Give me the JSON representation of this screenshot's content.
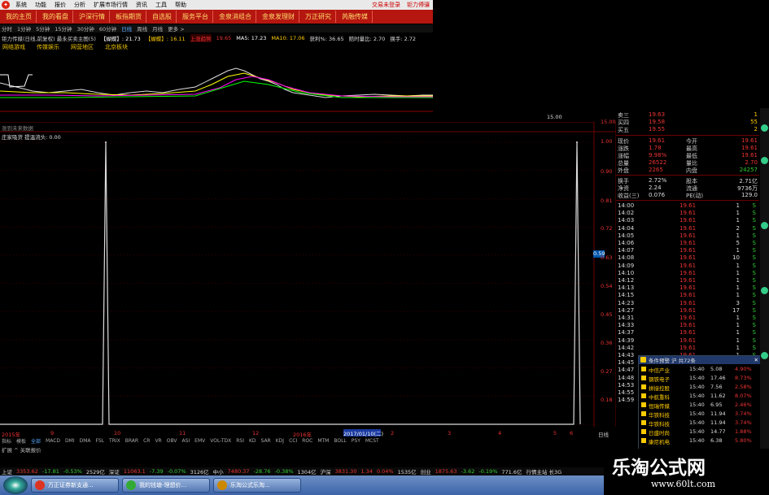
{
  "menubar": {
    "items": [
      "系统",
      "功能",
      "报价",
      "分析",
      "扩展市场行情",
      "资讯",
      "工具",
      "帮助"
    ],
    "right": [
      "交易未登录",
      "钜力傅骧"
    ]
  },
  "navbar": {
    "tabs": [
      "我的主页",
      "我的看盘",
      "沪深行情",
      "板指期货",
      "自选股",
      "服务平台",
      "金泉消组合",
      "金泉发理财",
      "万正研究",
      "芮融传媒"
    ]
  },
  "periodbar": {
    "items": [
      "分时",
      "1分钟",
      "5分钟",
      "15分钟",
      "30分钟",
      "60分钟",
      "日线",
      "周线",
      "月线",
      "更多 >"
    ],
    "active": "日线"
  },
  "infobar": {
    "title": "钜力传媒(日线,前复权) 最永买卖主图(5)",
    "v1": "【蝴蝶】: 21.73",
    "v2": "【蝴蝶】: 16.11",
    "v3": "上涨趋势",
    "v4": "19.65",
    "v5": "MA5: 17.23",
    "v6": "MA10: 17.06",
    "v7": "获利%: 36.65",
    "v8": "赔时量比: 2.70",
    "v9": "换手: 2.72"
  },
  "tags": [
    "网络游戏",
    "传媒娱乐",
    "网营地区",
    "北京板块"
  ],
  "chart": {
    "title": "涨到未来数据",
    "indicator": "庄家吸货  提温流头: 0.00",
    "ylabels": [
      "1.00",
      "0.90",
      "0.81",
      "0.72",
      "0.63",
      "0.54",
      "0.45",
      "0.36",
      "0.27",
      "0.18",
      "0.09"
    ],
    "current": "0.59",
    "top_value": "15.00",
    "top_value2": "15.00",
    "x_labels": [
      "2015年",
      "9",
      "10",
      "11",
      "12",
      "2016年",
      "2",
      "3",
      "4",
      "5",
      "6",
      "7",
      "8"
    ],
    "x_highlight": "2017/01/10(二)",
    "x_end": "日线"
  },
  "chart_data": {
    "type": "line",
    "title": "",
    "xlabel": "",
    "ylabel": "",
    "ylim": [
      0,
      1.0
    ],
    "series": [
      {
        "name": "庄家吸货",
        "x": [
          "2015",
          "9",
          "10",
          "11",
          "12",
          "2016",
          "2",
          "3",
          "4",
          "5",
          "6",
          "7",
          "8"
        ],
        "values": [
          0,
          1.0,
          0,
          0,
          0,
          0,
          0,
          0,
          0,
          0,
          0,
          0,
          1.0
        ]
      }
    ]
  },
  "quote": {
    "sell": [
      {
        "label": "卖三",
        "price": "19.63",
        "vol": "1"
      },
      {
        "label": "买四",
        "price": "19.58",
        "vol": "55"
      },
      {
        "label": "买五",
        "price": "19.55",
        "vol": "2"
      }
    ],
    "stats": [
      {
        "l": "现价",
        "v": "19.61",
        "r": "今开",
        "rv": "19.61"
      },
      {
        "l": "涨跌",
        "v": "1.78",
        "r": "最高",
        "rv": "19.61"
      },
      {
        "l": "涨幅",
        "v": "9.98%",
        "r": "最低",
        "rv": "19.61"
      },
      {
        "l": "总量",
        "v": "26522",
        "r": "量比",
        "rv": "2.70"
      },
      {
        "l": "外盘",
        "v": "2265",
        "r": "内盘",
        "rv": "24257"
      }
    ],
    "stats2": [
      {
        "l": "换手",
        "v": "2.72%",
        "r": "股本",
        "rv": "2.71亿"
      },
      {
        "l": "净资",
        "v": "2.24",
        "r": "流通",
        "rv": "9736万"
      },
      {
        "l": "收益(三)",
        "v": "0.076",
        "r": "PE(动)",
        "rv": "129.0"
      }
    ],
    "ticks": [
      [
        "14:00",
        "19.61",
        "1",
        "S"
      ],
      [
        "14:02",
        "19.61",
        "1",
        "S"
      ],
      [
        "14:03",
        "19.61",
        "1",
        "S"
      ],
      [
        "14:04",
        "19.61",
        "2",
        "S"
      ],
      [
        "14:05",
        "19.61",
        "1",
        "S"
      ],
      [
        "14:06",
        "19.61",
        "5",
        "S"
      ],
      [
        "14:07",
        "19.61",
        "1",
        "S"
      ],
      [
        "14:08",
        "19.61",
        "10",
        "S"
      ],
      [
        "14:09",
        "19.61",
        "1",
        "S"
      ],
      [
        "14:10",
        "19.61",
        "1",
        "S"
      ],
      [
        "14:12",
        "19.61",
        "1",
        "S"
      ],
      [
        "14:13",
        "19.61",
        "1",
        "S"
      ],
      [
        "14:15",
        "19.61",
        "1",
        "S"
      ],
      [
        "14:23",
        "19.61",
        "3",
        "S"
      ],
      [
        "14:27",
        "19.61",
        "17",
        "S"
      ],
      [
        "14:31",
        "19.61",
        "1",
        "S"
      ],
      [
        "14:33",
        "19.61",
        "1",
        "S"
      ],
      [
        "14:37",
        "19.61",
        "1",
        "S"
      ],
      [
        "14:39",
        "19.61",
        "1",
        "S"
      ],
      [
        "14:42",
        "19.61",
        "1",
        "S"
      ],
      [
        "14:43",
        "19.61",
        "1",
        "S"
      ],
      [
        "14:45",
        "19.61",
        "1",
        "S"
      ],
      [
        "14:47",
        "19.61",
        "1",
        "S"
      ],
      [
        "14:48",
        "19.61",
        "1",
        "S"
      ],
      [
        "14:53",
        "19.61",
        "1",
        "S"
      ],
      [
        "14:55",
        "19.61",
        "1",
        "S"
      ],
      [
        "14:59",
        "19.61",
        "1",
        "S"
      ]
    ]
  },
  "popup": {
    "title": "条件预警 沪 共72条",
    "rows": [
      [
        "中信产业",
        "15:40",
        "5.08",
        "4.90%"
      ],
      [
        "钢铁电子",
        "15:40",
        "17.46",
        "8.73%"
      ],
      [
        "拼接控股",
        "15:40",
        "7.56",
        "2.58%"
      ],
      [
        "中航重科",
        "15:40",
        "11.62",
        "8.07%"
      ],
      [
        "恒瑞传媒",
        "15:40",
        "6.95",
        "2.46%"
      ],
      [
        "华铁科技",
        "15:40",
        "11.94",
        "3.74%"
      ],
      [
        "华铁科技",
        "15:40",
        "11.94",
        "3.74%"
      ],
      [
        "日盛时尚",
        "15:40",
        "14.77",
        "1.88%"
      ],
      [
        "康尼机电",
        "15:40",
        "6.38",
        "5.80%"
      ]
    ]
  },
  "indtabs": [
    "指标",
    "模板",
    "全部",
    "MACD",
    "DMI",
    "DMA",
    "FSL",
    "TRIX",
    "BRAR",
    "CR",
    "VR",
    "OBV",
    "ASI",
    "EMV",
    "VOL-TDX",
    "RSI",
    "KD",
    "SAR",
    "KDJ",
    "CCI",
    "ROC",
    "MTM",
    "BOLL",
    "PSY",
    "MCST"
  ],
  "expand": "扩展 ^   关联报价",
  "status": [
    {
      "t": "上证",
      "c": "#ddd"
    },
    {
      "t": "3353.62",
      "c": "#e33"
    },
    {
      "t": "-17.81",
      "c": "#3c3"
    },
    {
      "t": "-0.53%",
      "c": "#3c3"
    },
    {
      "t": "2529亿",
      "c": "#ddd"
    },
    {
      "t": "深证",
      "c": "#ddd"
    },
    {
      "t": "11063.1",
      "c": "#e33"
    },
    {
      "t": "-7.39",
      "c": "#3c3"
    },
    {
      "t": "-0.07%",
      "c": "#3c3"
    },
    {
      "t": "3126亿",
      "c": "#ddd"
    },
    {
      "t": "中小",
      "c": "#ddd"
    },
    {
      "t": "7480.37",
      "c": "#e33"
    },
    {
      "t": "-28.76",
      "c": "#3c3"
    },
    {
      "t": "-0.38%",
      "c": "#3c3"
    },
    {
      "t": "1304亿",
      "c": "#ddd"
    },
    {
      "t": "沪深",
      "c": "#ddd"
    },
    {
      "t": "3831.30",
      "c": "#e33"
    },
    {
      "t": "1.34",
      "c": "#e33"
    },
    {
      "t": "0.04%",
      "c": "#e33"
    },
    {
      "t": "1535亿",
      "c": "#ddd"
    },
    {
      "t": "创业",
      "c": "#ddd"
    },
    {
      "t": "1875.63",
      "c": "#e33"
    },
    {
      "t": "-3.62",
      "c": "#3c3"
    },
    {
      "t": "-0.19%",
      "c": "#3c3"
    },
    {
      "t": "771.6亿",
      "c": "#ddd"
    },
    {
      "t": "行情主站 长3G",
      "c": "#ddd"
    }
  ],
  "taskbar": {
    "tasks": [
      "万正证券新支通...",
      "我的钱塘-理想价...",
      "乐淘公式乐淘..."
    ]
  },
  "watermark": {
    "title": "乐淘公式网",
    "url": "www.60lt.com"
  }
}
